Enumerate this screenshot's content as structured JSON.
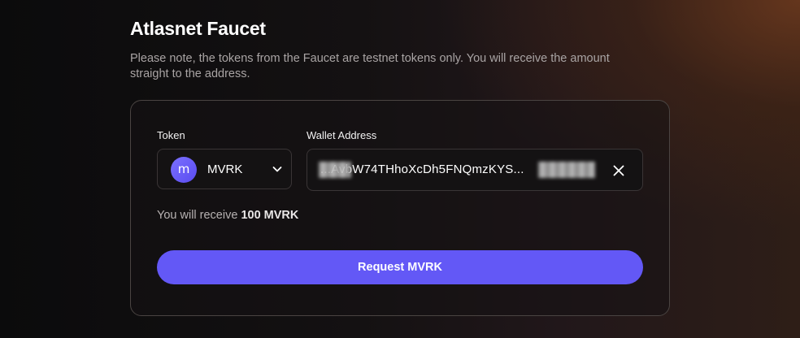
{
  "header": {
    "title": "Atlasnet Faucet",
    "note": "Please note, the tokens from the Faucet are testnet tokens only. You will receive the amount straight to the address."
  },
  "form": {
    "token_label": "Token",
    "wallet_label": "Wallet Address",
    "token": {
      "symbol": "MVRK",
      "logo_glyph": "m",
      "icon": "chevron-down-icon"
    },
    "wallet": {
      "value": "...AvbW74THhoXcDh5FNQmzKYS...",
      "clear_icon": "close-icon"
    },
    "receive_prefix": "You will receive",
    "receive_amount": "100 MVRK",
    "submit_label": "Request MVRK"
  },
  "colors": {
    "accent": "#6358f6",
    "token_logo": "#6c60fa"
  }
}
